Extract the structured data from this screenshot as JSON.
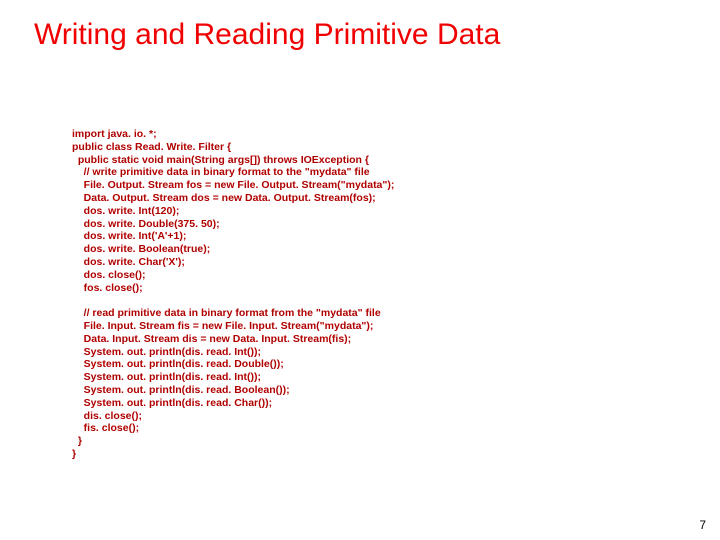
{
  "title": "Writing and Reading Primitive Data",
  "page_number": "7",
  "code": {
    "l01": "import java. io. *;",
    "l02": "public class Read. Write. Filter {",
    "l03": "  public static void main(String args[]) throws IOException {",
    "l04": "    // write primitive data in binary format to the \"mydata\" file",
    "l05": "    File. Output. Stream fos = new File. Output. Stream(\"mydata\");",
    "l06": "    Data. Output. Stream dos = new Data. Output. Stream(fos);",
    "l07": "    dos. write. Int(120);",
    "l08": "    dos. write. Double(375. 50);",
    "l09": "    dos. write. Int('A'+1);",
    "l10": "    dos. write. Boolean(true);",
    "l11": "    dos. write. Char('X');",
    "l12": "    dos. close();",
    "l13": "    fos. close();",
    "l14": "",
    "l15": "    // read primitive data in binary format from the \"mydata\" file",
    "l16": "    File. Input. Stream fis = new File. Input. Stream(\"mydata\");",
    "l17": "    Data. Input. Stream dis = new Data. Input. Stream(fis);",
    "l18": "    System. out. println(dis. read. Int());",
    "l19": "    System. out. println(dis. read. Double());",
    "l20": "    System. out. println(dis. read. Int());",
    "l21": "    System. out. println(dis. read. Boolean());",
    "l22": "    System. out. println(dis. read. Char());",
    "l23": "    dis. close();",
    "l24": "    fis. close();",
    "l25": "  }",
    "l26": "}"
  }
}
